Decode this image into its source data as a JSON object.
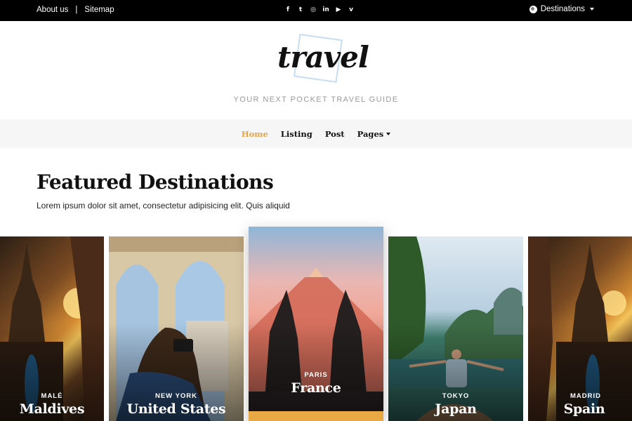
{
  "topbar": {
    "about_label": "About us",
    "separator": "|",
    "sitemap_label": "Sitemap",
    "socials": [
      {
        "icon": "facebook-icon",
        "glyph": "f"
      },
      {
        "icon": "twitter-icon",
        "glyph": "t"
      },
      {
        "icon": "instagram-icon",
        "glyph": "◎"
      },
      {
        "icon": "linkedin-icon",
        "glyph": "in"
      },
      {
        "icon": "youtube-icon",
        "glyph": "▶"
      },
      {
        "icon": "vimeo-icon",
        "glyph": "v"
      }
    ],
    "destinations_label": "Destinations"
  },
  "header": {
    "logo_text": "travel",
    "tagline": "YOUR NEXT POCKET TRAVEL GUIDE"
  },
  "nav": {
    "items": [
      {
        "label": "Home",
        "active": true
      },
      {
        "label": "Listing"
      },
      {
        "label": "Post"
      },
      {
        "label": "Pages",
        "dropdown": true
      }
    ]
  },
  "featured": {
    "title": "Featured Destinations",
    "subtitle": "Lorem ipsum dolor sit amet, consectetur adipisicing elit. Quis aliquid"
  },
  "cards": [
    {
      "city": "MALÉ",
      "country": "Maldives"
    },
    {
      "city": "NEW YORK",
      "country": "United States"
    },
    {
      "city": "PARIS",
      "country": "France"
    },
    {
      "city": "TOKYO",
      "country": "Japan"
    },
    {
      "city": "MADRID",
      "country": "Spain"
    }
  ],
  "colors": {
    "accent": "#e6a446",
    "topbar": "#000000",
    "nav_bg": "#f6f6f6"
  }
}
